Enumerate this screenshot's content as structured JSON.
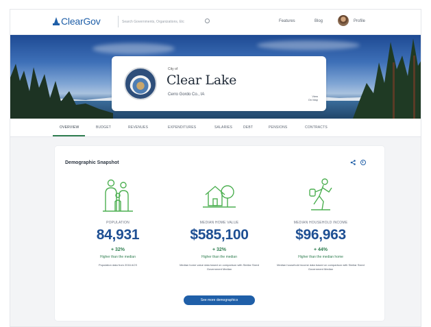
{
  "brand": {
    "name": "ClearGov"
  },
  "search": {
    "placeholder": "Search Governments, Organizations, Etc"
  },
  "nav": {
    "links": [
      "Features",
      "Blog"
    ],
    "user": "Profile"
  },
  "hero": {
    "kicker": "City of",
    "city": "Clear Lake",
    "county": "Cerro Gordo Co., IA",
    "map_link": "View\nOn Map"
  },
  "tabs": [
    "Overview",
    "Budget",
    "Revenues",
    "Expenditures",
    "Salaries",
    "Debt",
    "Pensions",
    "Contracts"
  ],
  "panel": {
    "title": "Demographic Snapshot",
    "stats": [
      {
        "label": "Population",
        "value": "84,931",
        "change": "+ 32%",
        "note": "Higher than the median",
        "desc": "Population data from 2016 ACS"
      },
      {
        "label": "Median Home Value",
        "value": "$585,100",
        "change": "+ 32%",
        "note": "Higher than the median",
        "desc": "Median home value data based on comparison with Similar Sized Government Median"
      },
      {
        "label": "Median Household Income",
        "value": "$96,963",
        "change": "+ 44%",
        "note": "Higher than the median home",
        "desc": "Median household income data based on comparison with Similar Sized Government Median"
      }
    ],
    "more_button": "See more demographics"
  },
  "colors": {
    "primary": "#1f5fa8",
    "stat_value": "#1e4f93",
    "positive": "#2e7d4f",
    "illustration": "#4caf50"
  },
  "icons": [
    "family-icon",
    "home-icon",
    "income-icon",
    "share-icon",
    "info-icon",
    "search-icon"
  ]
}
